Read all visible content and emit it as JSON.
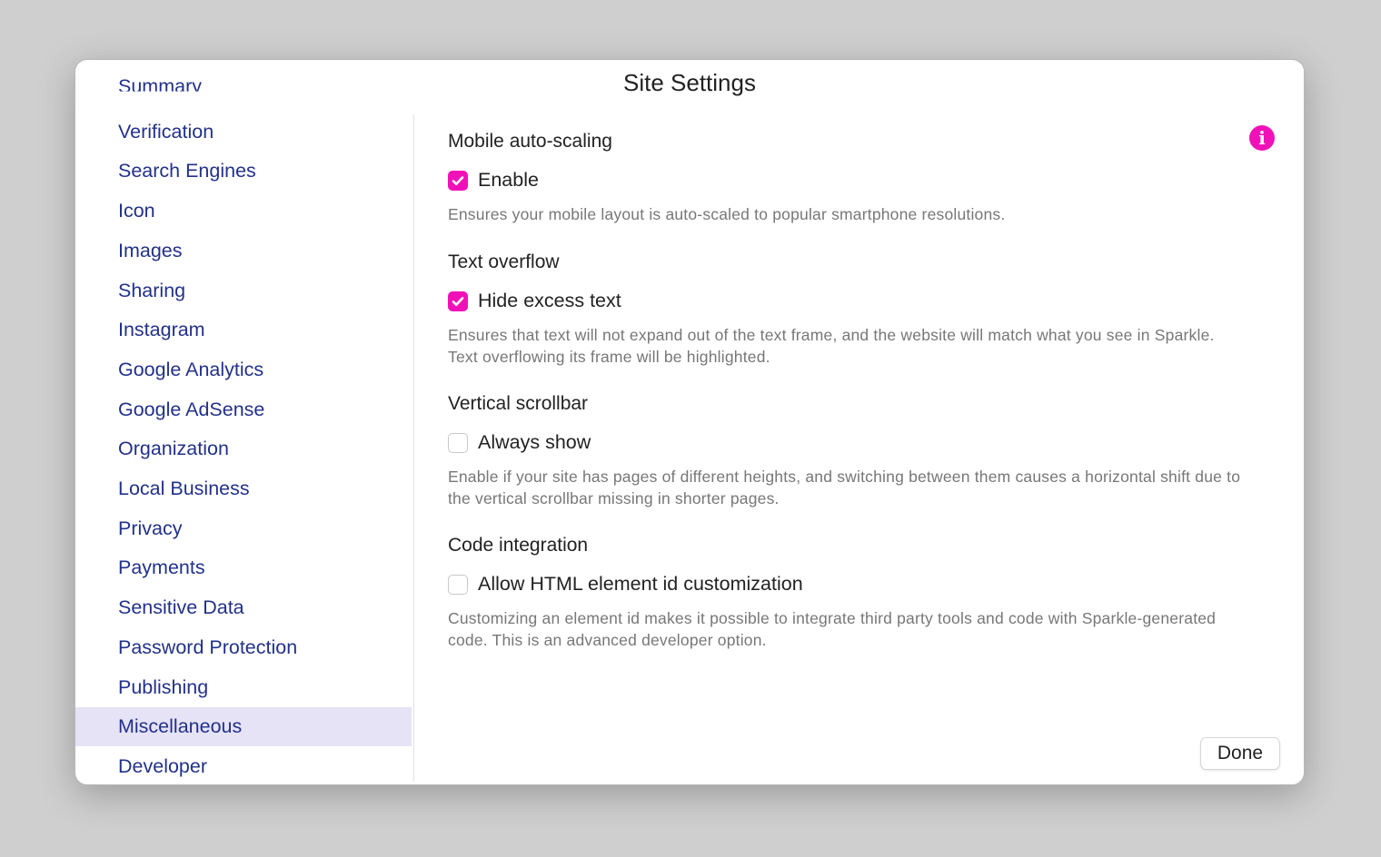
{
  "window": {
    "title": "Site Settings"
  },
  "sidebar": {
    "items": [
      "Summary",
      "Verification",
      "Search Engines",
      "Icon",
      "Images",
      "Sharing",
      "Instagram",
      "Google Analytics",
      "Google AdSense",
      "Organization",
      "Local Business",
      "Privacy",
      "Payments",
      "Sensitive Data",
      "Password Protection",
      "Publishing",
      "Miscellaneous",
      "Developer"
    ],
    "selected": "Miscellaneous"
  },
  "sections": [
    {
      "heading": "Mobile auto-scaling",
      "option": "Enable",
      "checked": true,
      "description": "Ensures your mobile layout is auto-scaled to popular smartphone resolutions."
    },
    {
      "heading": "Text overflow",
      "option": "Hide excess text",
      "checked": true,
      "description": "Ensures that text will not expand out of the text frame, and the website will match what you see in Sparkle. Text overflowing its frame will be highlighted."
    },
    {
      "heading": "Vertical scrollbar",
      "option": "Always show",
      "checked": false,
      "description": "Enable if your site has pages of different heights, and switching between them causes a horizontal shift due to the vertical scrollbar missing in shorter pages."
    },
    {
      "heading": "Code integration",
      "option": "Allow HTML element id customization",
      "checked": false,
      "description": "Customizing an element id makes it possible to integrate third party tools and code with Sparkle-generated code. This is an advanced developer option."
    }
  ],
  "info_icon": "info-icon",
  "done_label": "Done",
  "colors": {
    "accent": "#f012b8",
    "link": "#22318a",
    "selected_bg": "#e6e3f7"
  }
}
